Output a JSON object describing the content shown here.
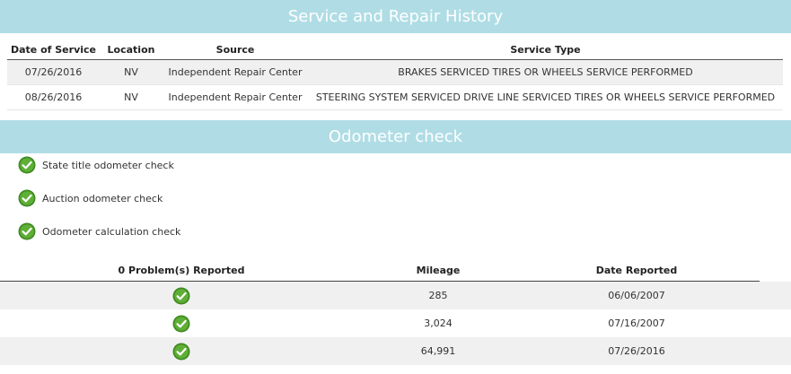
{
  "service_history": {
    "title": "Service and Repair History",
    "columns": [
      "Date of Service",
      "Location",
      "Source",
      "Service Type"
    ],
    "rows": [
      {
        "date": "07/26/2016",
        "location": "NV",
        "source": "Independent Repair Center",
        "service_type": "BRAKES SERVICED TIRES OR WHEELS SERVICE PERFORMED"
      },
      {
        "date": "08/26/2016",
        "location": "NV",
        "source": "Independent Repair Center",
        "service_type": "STEERING SYSTEM SERVICED DRIVE LINE SERVICED TIRES OR WHEELS SERVICE PERFORMED"
      }
    ]
  },
  "odometer": {
    "title": "Odometer check",
    "checks": [
      {
        "label": "State title odometer check",
        "icon": "check-circle-icon"
      },
      {
        "label": "Auction odometer check",
        "icon": "check-circle-icon"
      },
      {
        "label": "Odometer calculation check",
        "icon": "check-circle-icon"
      }
    ],
    "columns": [
      "0 Problem(s) Reported",
      "Mileage",
      "Date Reported"
    ],
    "rows": [
      {
        "status_icon": "check-circle-icon",
        "mileage": "285",
        "date": "06/06/2007"
      },
      {
        "status_icon": "check-circle-icon",
        "mileage": "3,024",
        "date": "07/16/2007"
      },
      {
        "status_icon": "check-circle-icon",
        "mileage": "64,991",
        "date": "07/26/2016"
      }
    ]
  },
  "colors": {
    "banner": "#b0dde5",
    "check_green": "#4f9a2e",
    "row_shade": "#f0f0f0"
  }
}
